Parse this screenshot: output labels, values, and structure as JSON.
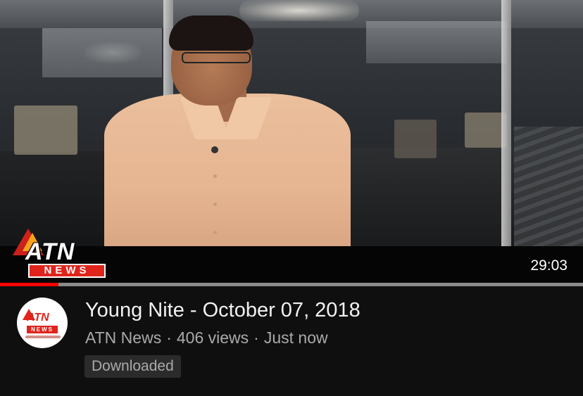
{
  "video": {
    "thumbnail_logo": {
      "brand": "ATN",
      "sub": "NEWS"
    },
    "duration": "29:03",
    "progress_fraction": 0.1
  },
  "info": {
    "title": "Young Nite - October 07, 2018",
    "channel": "ATN News",
    "views": "406 views",
    "age": "Just now",
    "separator": "·",
    "badge": "Downloaded"
  },
  "avatar": {
    "brand": "ATN",
    "sub": "NEWS"
  },
  "colors": {
    "background": "#0f0f0f",
    "progress": "#ff0000",
    "brand_red": "#e0241c",
    "brand_orange": "#f6a21c"
  }
}
